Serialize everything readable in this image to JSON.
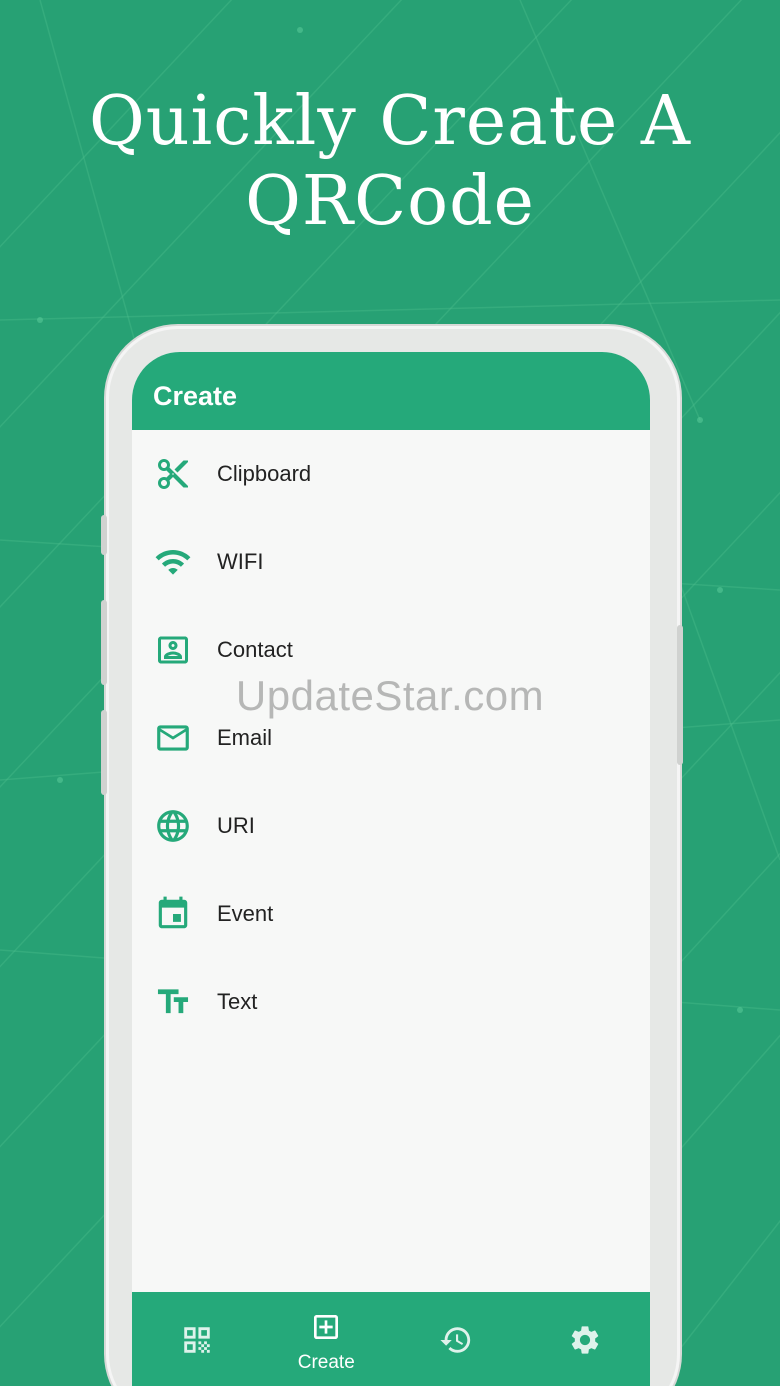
{
  "headline": {
    "line1": "Quickly Create A",
    "line2": "QRCode"
  },
  "app_bar": {
    "title": "Create"
  },
  "menu": {
    "items": [
      {
        "label": "Clipboard",
        "icon": "scissors-icon"
      },
      {
        "label": "WIFI",
        "icon": "wifi-icon"
      },
      {
        "label": "Contact",
        "icon": "contact-card-icon"
      },
      {
        "label": "Email",
        "icon": "envelope-icon"
      },
      {
        "label": "URI",
        "icon": "globe-icon"
      },
      {
        "label": "Event",
        "icon": "calendar-icon"
      },
      {
        "label": "Text",
        "icon": "text-size-icon"
      }
    ]
  },
  "watermark": "UpdateStar.com",
  "bottom_nav": {
    "items": [
      {
        "label": "",
        "icon": "qr-scan-icon"
      },
      {
        "label": "Create",
        "icon": "plus-box-icon",
        "active": true
      },
      {
        "label": "",
        "icon": "history-icon"
      },
      {
        "label": "",
        "icon": "gear-icon"
      }
    ]
  },
  "colors": {
    "brand_green": "#25a97a",
    "background_green": "#27a174",
    "screen_bg": "#f7f8f7"
  }
}
